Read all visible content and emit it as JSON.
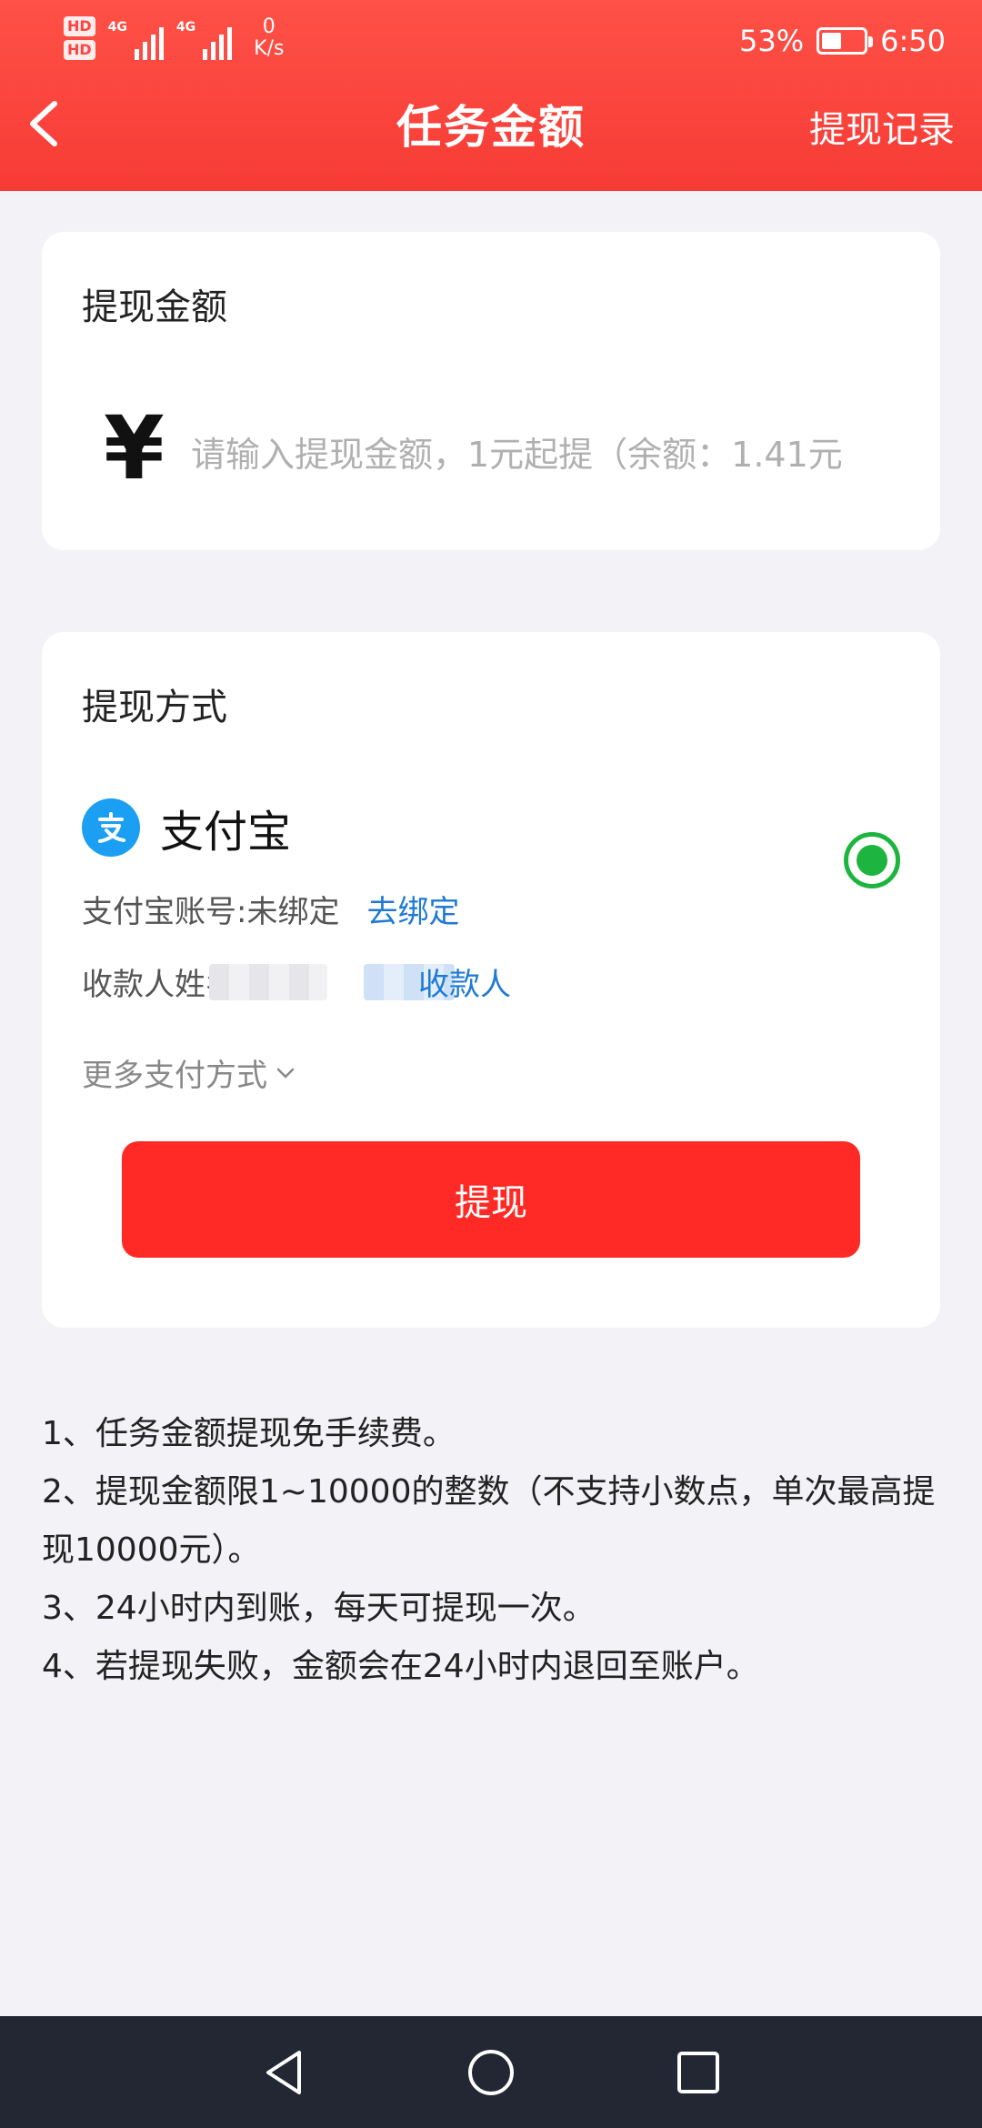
{
  "status_bar": {
    "hd1": "HD",
    "hd2": "HD",
    "net1": "4G",
    "net2": "4G",
    "speed_value": "0",
    "speed_unit": "K/s",
    "battery": "53%",
    "battery_level": 0.53,
    "time": "6:50"
  },
  "header": {
    "title": "任务金额",
    "history_link": "提现记录"
  },
  "amount_card": {
    "title": "提现金额",
    "currency": "¥",
    "placeholder": "请输入提现金额，1元起提（余额：1.41元"
  },
  "method_card": {
    "title": "提现方式",
    "alipay_name": "支付宝",
    "account_label": "支付宝账号:未绑定",
    "bind_link": "去绑定",
    "payee_label": "收款人姓名",
    "payee_link": "收款人",
    "more_methods": "更多支付方式",
    "submit_label": "提现"
  },
  "notes": [
    "1、任务金额提现免手续费。",
    "2、提现金额限1~10000的整数（不支持小数点，单次最高提现10000元）。",
    "3、24小时内到账，每天可提现一次。",
    "4、若提现失败，金额会在24小时内退回至账户。"
  ],
  "colors": {
    "header": "#f63b35",
    "submit": "#ff2a26",
    "link": "#1f7ad6",
    "radio": "#1db53f",
    "alipay": "#1a9ff2"
  },
  "icons": {
    "back": "chevron-left-icon",
    "radio": "radio-selected-icon",
    "alipay": "alipay-icon",
    "more": "chevron-down-icon",
    "nav_back": "triangle-back-icon",
    "nav_home": "circle-home-icon",
    "nav_recent": "square-recent-icon"
  }
}
